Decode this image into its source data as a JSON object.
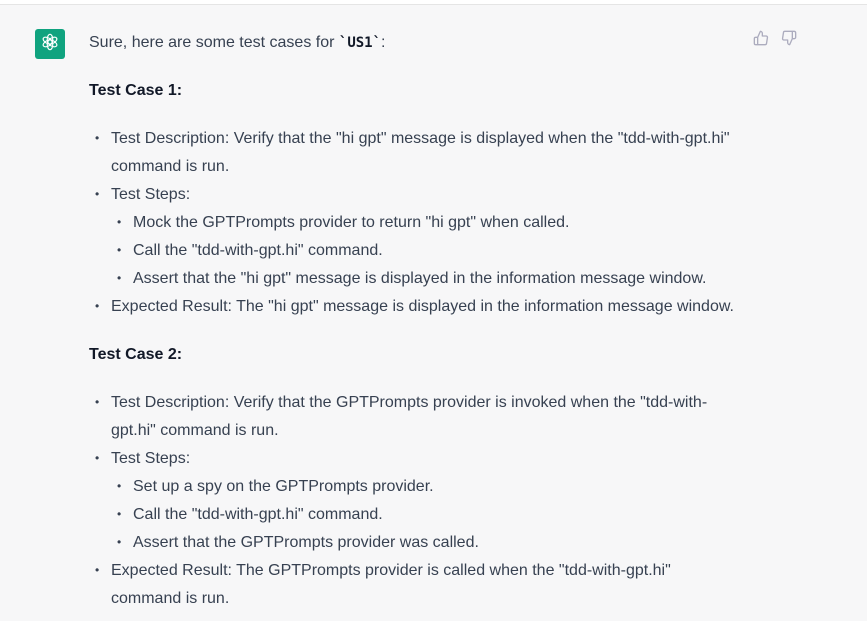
{
  "message": {
    "intro_prefix": "Sure, here are some test cases for ",
    "intro_code": "`US1`",
    "intro_suffix": ":",
    "cases": [
      {
        "title": "Test Case 1:",
        "description_line1": "Test Description: Verify that the \"hi gpt\" message is displayed when the \"tdd-with-gpt.hi\"",
        "description_line2": "command is run.",
        "steps_label": "Test Steps:",
        "steps": [
          "Mock the GPTPrompts provider to return \"hi gpt\" when called.",
          "Call the \"tdd-with-gpt.hi\" command.",
          "Assert that the \"hi gpt\" message is displayed in the information message window."
        ],
        "expected_line1": "Expected Result: The \"hi gpt\" message is displayed in the information message window.",
        "expected_line2": ""
      },
      {
        "title": "Test Case 2:",
        "description_line1": "Test Description: Verify that the GPTPrompts provider is invoked when the \"tdd-with-",
        "description_line2": "gpt.hi\" command is run.",
        "steps_label": "Test Steps:",
        "steps": [
          "Set up a spy on the GPTPrompts provider.",
          "Call the \"tdd-with-gpt.hi\" command.",
          "Assert that the GPTPrompts provider was called."
        ],
        "expected_line1": "Expected Result: The GPTPrompts provider is called when the \"tdd-with-gpt.hi\"",
        "expected_line2": "command is run."
      }
    ]
  },
  "icons": {
    "avatar": "openai-logo-icon",
    "thumbs_up": "thumbs-up-icon",
    "thumbs_down": "thumbs-down-icon"
  },
  "colors": {
    "avatar_bg": "#10a37f",
    "message_bg": "#f7f7f8",
    "text": "#374151",
    "icon": "#acacbe"
  }
}
